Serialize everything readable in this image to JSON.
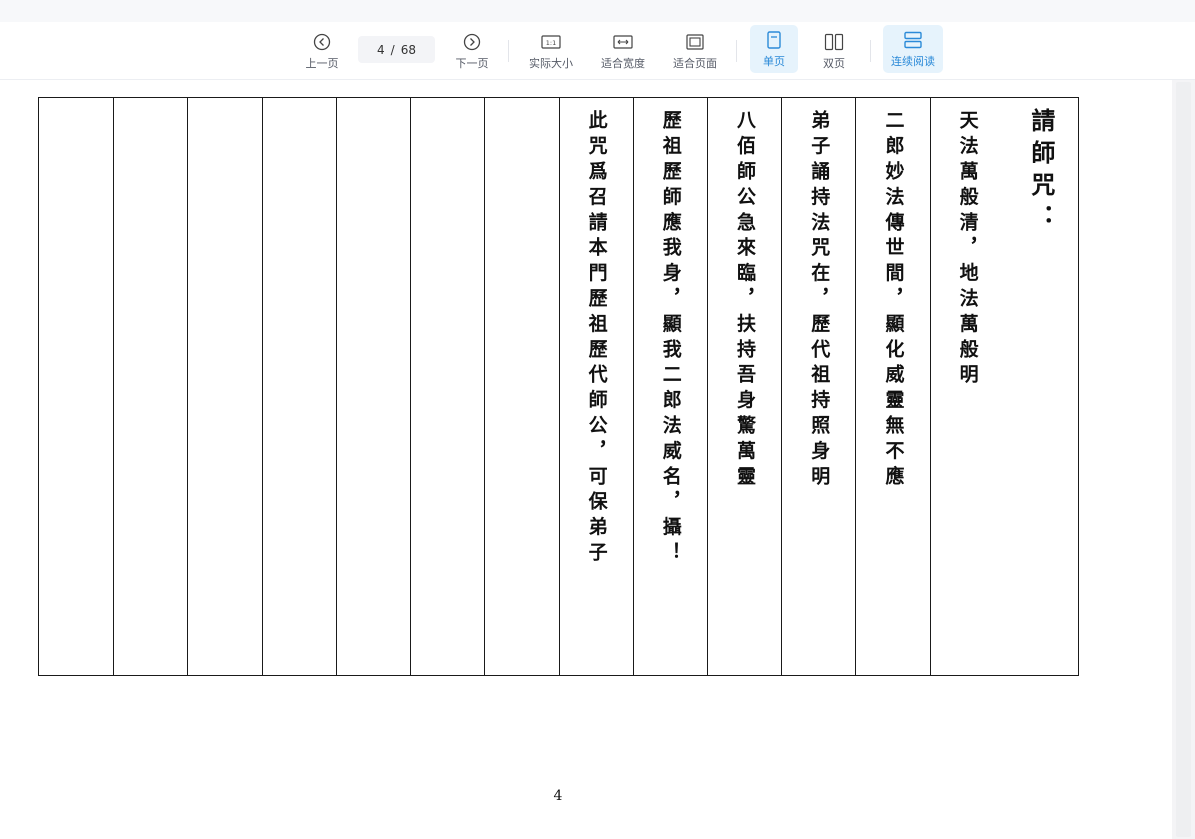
{
  "toolbar": {
    "prev_label": "上一页",
    "next_label": "下一页",
    "current_page": "4",
    "page_separator": "/",
    "total_pages": "68",
    "actual_size_label": "实际大小",
    "actual_size_icon_text": "1:1",
    "fit_width_label": "适合宽度",
    "fit_page_label": "适合页面",
    "single_page_label": "单页",
    "double_page_label": "双页",
    "continuous_label": "连续阅读",
    "accent_color": "#2b8ad8",
    "active_bg": "#e6f3fc",
    "icons": {
      "prev": "chevron-left-circle-icon",
      "next": "chevron-right-circle-icon",
      "actual_size": "actual-size-icon",
      "fit_width": "fit-width-icon",
      "fit_page": "fit-page-icon",
      "single_page": "single-page-icon",
      "double_page": "double-page-icon",
      "continuous": "continuous-read-icon"
    }
  },
  "document": {
    "columns": [
      "請師咒：",
      "天法萬般清，地法萬般明",
      "二郎妙法傳世間，顯化威靈無不應",
      "弟子誦持法咒在，歷代祖持照身明",
      "八佰師公急來臨，扶持吾身驚萬靈",
      "歷祖歷師應我身，顯我二郎法威名，攝！",
      "此咒爲召請本門歷祖歷代師公，可保弟子",
      "",
      "",
      "",
      "",
      "",
      "",
      ""
    ],
    "page_number": "4"
  }
}
